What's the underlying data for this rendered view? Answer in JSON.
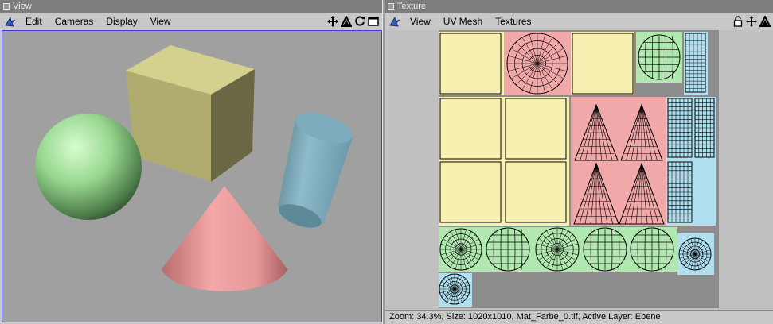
{
  "view_window": {
    "title": "View",
    "menu": [
      "Edit",
      "Cameras",
      "Display",
      "View"
    ],
    "tools": [
      "move-icon",
      "rotate-icon",
      "refresh-icon",
      "maximize-icon"
    ]
  },
  "texture_window": {
    "title": "Texture",
    "menu": [
      "View",
      "UV Mesh",
      "Textures"
    ],
    "tools": [
      "lock-icon",
      "move-icon",
      "rotate-icon"
    ],
    "status": "Zoom: 34.3%, Size: 1020x1010, Mat_Farbe_0.tif, Active Layer: Ebene"
  },
  "colors": {
    "yellow": "#f8f0b0",
    "pink": "#f0a8a8",
    "green": "#b0e8b0",
    "blue": "#b0e0f0",
    "accent": "#4040c0"
  }
}
